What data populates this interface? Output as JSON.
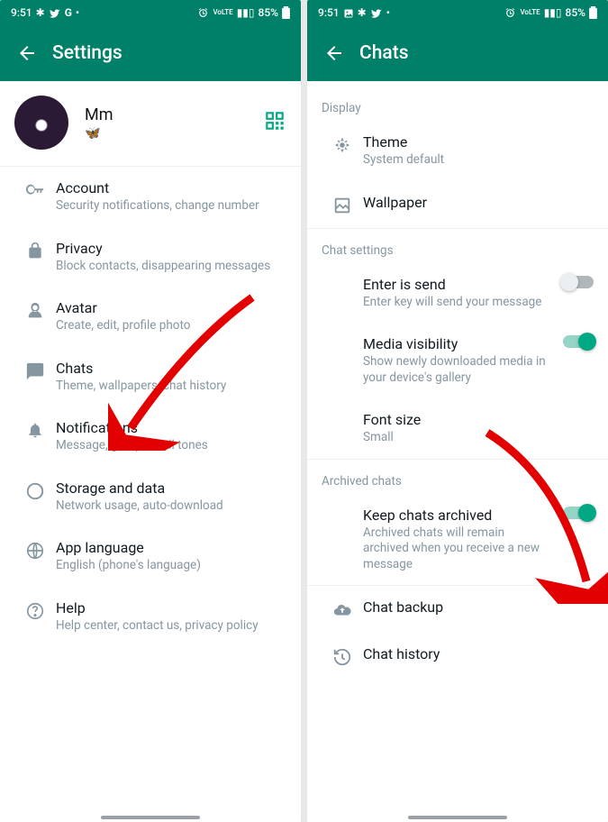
{
  "status": {
    "time": "9:51",
    "battery": "85%",
    "icons_left": [
      "slack",
      "twitter",
      "google",
      "dot"
    ],
    "icons_left_alt": [
      "slack",
      "image",
      "twitter",
      "dot"
    ],
    "icons_right": [
      "alarm",
      "wifi-off",
      "volte",
      "signal",
      "battery"
    ]
  },
  "left": {
    "title": "Settings",
    "profile": {
      "name": "Mm",
      "status": "🦋"
    },
    "items": [
      {
        "icon": "key",
        "title": "Account",
        "sub": "Security notifications, change number"
      },
      {
        "icon": "lock",
        "title": "Privacy",
        "sub": "Block contacts, disappearing messages"
      },
      {
        "icon": "avatar",
        "title": "Avatar",
        "sub": "Create, edit, profile photo"
      },
      {
        "icon": "chat",
        "title": "Chats",
        "sub": "Theme, wallpapers, chat history"
      },
      {
        "icon": "bell",
        "title": "Notifications",
        "sub": "Message, group & call tones"
      },
      {
        "icon": "data",
        "title": "Storage and data",
        "sub": "Network usage, auto-download"
      },
      {
        "icon": "globe",
        "title": "App language",
        "sub": "English (phone's language)"
      },
      {
        "icon": "help",
        "title": "Help",
        "sub": "Help center, contact us, privacy policy"
      }
    ]
  },
  "right": {
    "title": "Chats",
    "sections": {
      "display": {
        "header": "Display",
        "items": [
          {
            "icon": "theme",
            "title": "Theme",
            "sub": "System default"
          },
          {
            "icon": "wallpaper",
            "title": "Wallpaper",
            "sub": ""
          }
        ]
      },
      "chat_settings": {
        "header": "Chat settings",
        "items": [
          {
            "title": "Enter is send",
            "sub": "Enter key will send your message",
            "toggle": "off"
          },
          {
            "title": "Media visibility",
            "sub": "Show newly downloaded media in your device's gallery",
            "toggle": "on"
          },
          {
            "title": "Font size",
            "sub": "Small"
          }
        ]
      },
      "archived": {
        "header": "Archived chats",
        "items": [
          {
            "title": "Keep chats archived",
            "sub": "Archived chats will remain archived when you receive a new message",
            "toggle": "on"
          }
        ]
      },
      "bottom": [
        {
          "icon": "cloud",
          "title": "Chat backup"
        },
        {
          "icon": "history",
          "title": "Chat history"
        }
      ]
    }
  }
}
